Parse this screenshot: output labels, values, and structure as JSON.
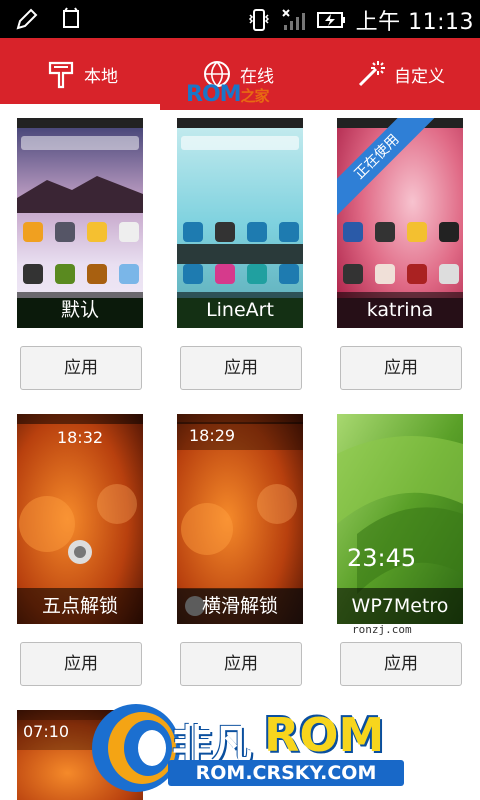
{
  "status_bar": {
    "time": "上午 11:13"
  },
  "tabs": [
    {
      "label": "本地",
      "icon": "theme-icon",
      "active": true
    },
    {
      "label": "在线",
      "icon": "globe-icon",
      "active": false
    },
    {
      "label": "自定义",
      "icon": "magic-wand-icon",
      "active": false
    }
  ],
  "rom_logo": {
    "rom": "ROM",
    "zhi": "之家"
  },
  "themes": [
    {
      "name": "默认",
      "apply_label": "应用"
    },
    {
      "name": "LineArt",
      "apply_label": "应用"
    },
    {
      "name": "katrina",
      "apply_label": "应用",
      "ribbon": "正在使用"
    },
    {
      "name": "五点解锁",
      "apply_label": "应用",
      "lock_time": "18:32"
    },
    {
      "name": "横滑解锁",
      "apply_label": "应用",
      "lock_time": "18:29"
    },
    {
      "name": "WP7Metro",
      "apply_label": "应用",
      "lock_time": "23:45"
    },
    {
      "name": "",
      "lock_time": "07:10"
    }
  ],
  "watermark": {
    "brand": "非凡",
    "rom": "ROM",
    "url": "ROM.CRSKY.COM",
    "small": "ronzj.com"
  },
  "colors": {
    "accent": "#d8232a",
    "ribbon": "#2f7fd6"
  }
}
